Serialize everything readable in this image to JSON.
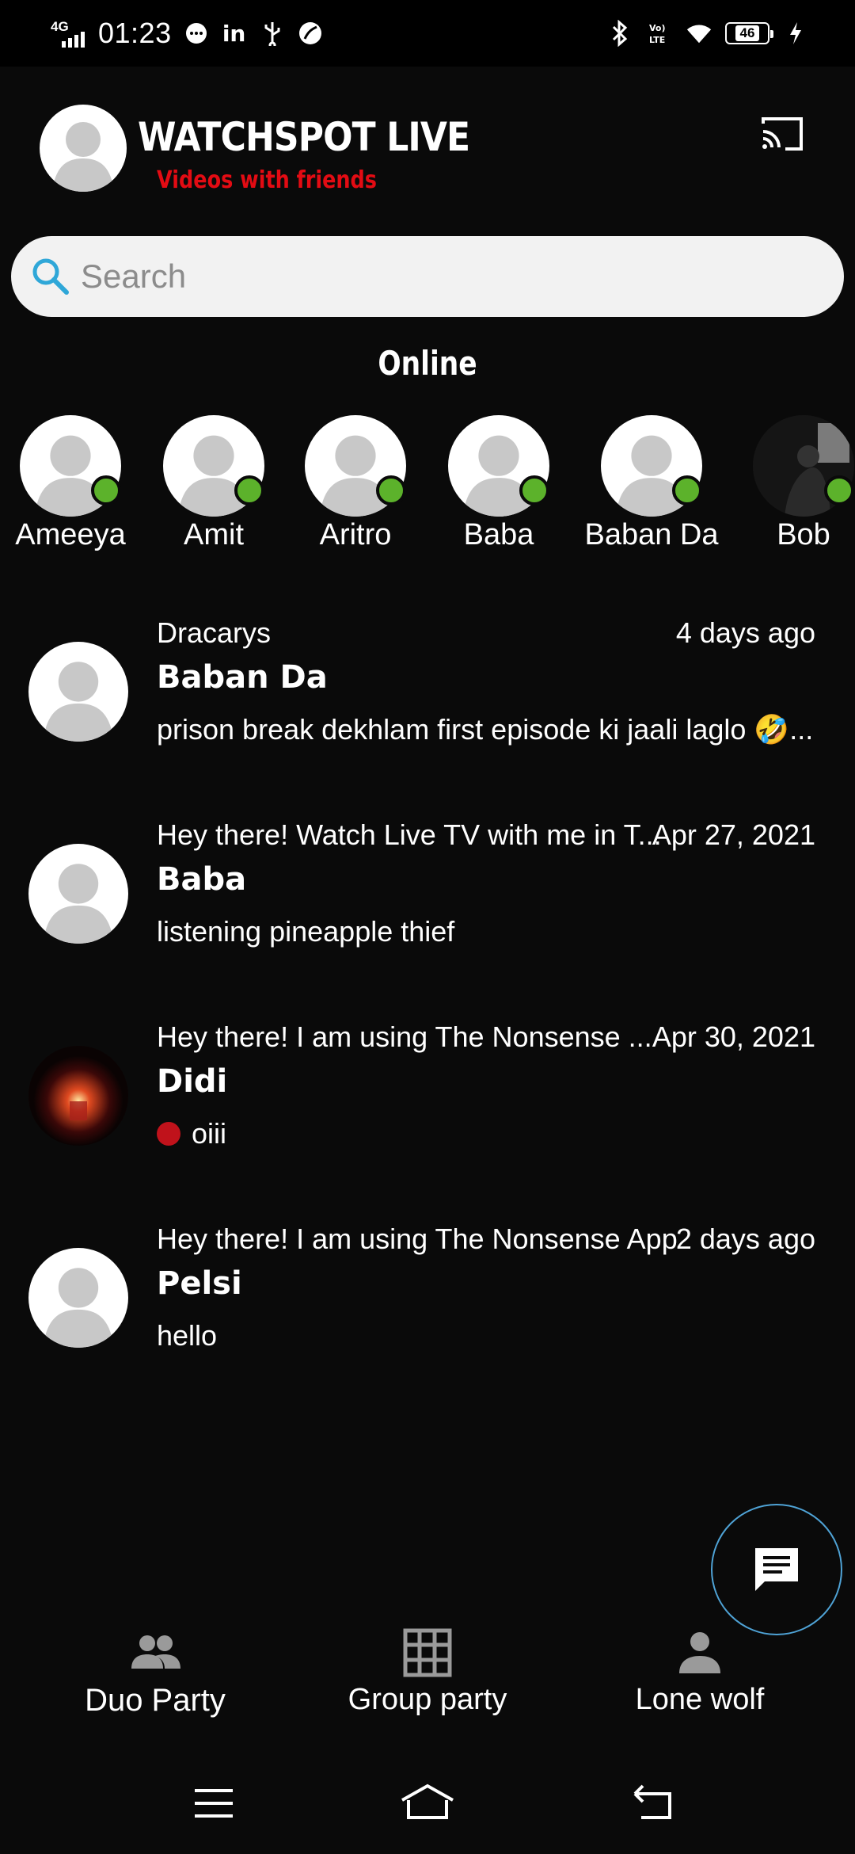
{
  "status_bar": {
    "network": "4G",
    "time": "01:23",
    "battery": "46",
    "colors": {
      "background": "#000000"
    }
  },
  "header": {
    "title": "WATCHSPOT LIVE",
    "subtitle": "Videos with friends",
    "subtitle_color": "#e30b13",
    "cast_icon": "cast-icon"
  },
  "search": {
    "placeholder": "Search",
    "value": ""
  },
  "online": {
    "title": "Online",
    "users": [
      {
        "name": "Ameeya"
      },
      {
        "name": "Amit"
      },
      {
        "name": "Aritro"
      },
      {
        "name": "Baba"
      },
      {
        "name": "Baban Da"
      },
      {
        "name": "Bob"
      }
    ],
    "online_color": "#5cb22b"
  },
  "chats": [
    {
      "status": "Dracarys",
      "time": "4 days ago",
      "name": "Baban Da",
      "message": "prison break dekhlam first episode ki jaali laglo 🤣..."
    },
    {
      "status": "Hey there! Watch Live TV with me in T...",
      "time": "Apr 27, 2021",
      "name": "Baba",
      "message": "listening pineapple thief"
    },
    {
      "status": "Hey there! I am using The Nonsense ...",
      "time": "Apr 30, 2021",
      "name": "Didi",
      "message": "oiii"
    },
    {
      "status": "Hey there! I am using The Nonsense App",
      "time": "2 days ago",
      "name": "Pelsi",
      "message": "hello"
    }
  ],
  "fab": {
    "icon": "chat-icon",
    "border_color": "#4fa3d6"
  },
  "bottom_nav": [
    {
      "label": "Duo Party",
      "icon": "people-icon"
    },
    {
      "label": "Group party",
      "icon": "grid-icon"
    },
    {
      "label": "Lone wolf",
      "icon": "person-icon"
    }
  ],
  "system_nav": [
    "menu-icon",
    "home-icon",
    "back-icon"
  ]
}
